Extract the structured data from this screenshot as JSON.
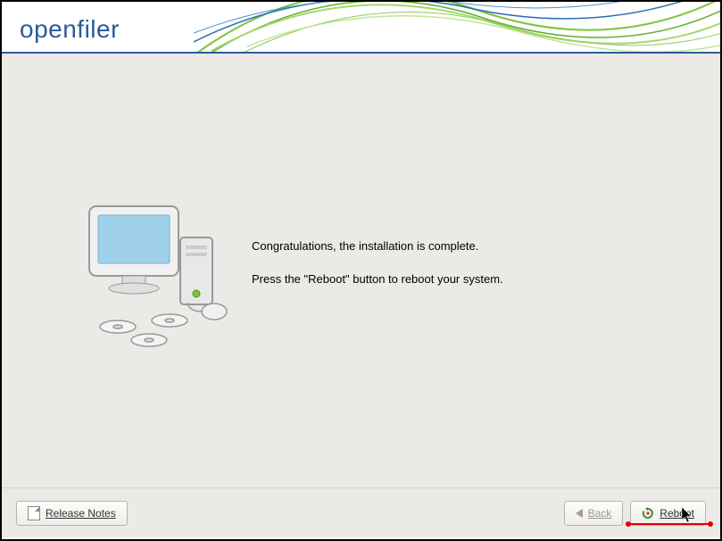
{
  "header": {
    "logo": "openfiler"
  },
  "content": {
    "line1": "Congratulations, the installation is complete.",
    "line2": "Press the \"Reboot\" button to reboot your system."
  },
  "footer": {
    "release_notes": "Release Notes",
    "back": "Back",
    "reboot": "Reboot"
  }
}
